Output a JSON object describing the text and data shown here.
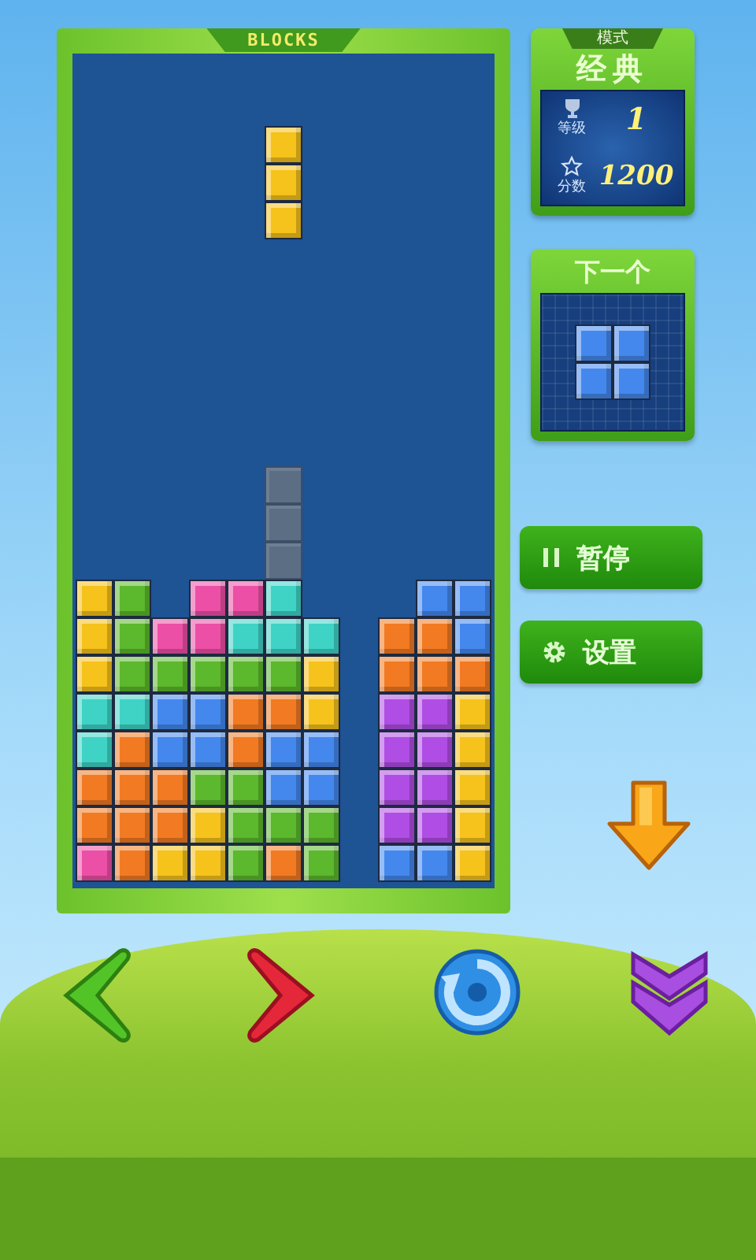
{
  "board": {
    "title": "BLOCKS",
    "rows": [
      [
        null,
        null,
        null,
        null,
        null,
        null,
        null,
        null,
        null,
        null,
        null
      ],
      [
        null,
        null,
        null,
        null,
        null,
        null,
        null,
        null,
        null,
        null,
        null
      ],
      [
        null,
        null,
        null,
        null,
        null,
        {
          "kind": "block",
          "color": "#f6c21c"
        },
        null,
        null,
        null,
        null,
        null
      ],
      [
        null,
        null,
        null,
        null,
        null,
        {
          "kind": "block",
          "color": "#f6c21c"
        },
        null,
        null,
        null,
        null,
        null
      ],
      [
        null,
        null,
        null,
        null,
        null,
        {
          "kind": "block",
          "color": "#f6c21c"
        },
        null,
        null,
        null,
        null,
        null
      ],
      [
        null,
        null,
        null,
        null,
        null,
        null,
        null,
        null,
        null,
        null,
        null
      ],
      [
        null,
        null,
        null,
        null,
        null,
        null,
        null,
        null,
        null,
        null,
        null
      ],
      [
        null,
        null,
        null,
        null,
        null,
        null,
        null,
        null,
        null,
        null,
        null
      ],
      [
        null,
        null,
        null,
        null,
        null,
        null,
        null,
        null,
        null,
        null,
        null
      ],
      [
        null,
        null,
        null,
        null,
        null,
        null,
        null,
        null,
        null,
        null,
        null
      ],
      [
        null,
        null,
        null,
        null,
        null,
        null,
        null,
        null,
        null,
        null,
        null
      ],
      [
        null,
        null,
        null,
        null,
        null,
        {
          "kind": "ghost",
          "color": "#5b6e84"
        },
        null,
        null,
        null,
        null,
        null
      ],
      [
        null,
        null,
        null,
        null,
        null,
        {
          "kind": "ghost",
          "color": "#5b6e84"
        },
        null,
        null,
        null,
        null,
        null
      ],
      [
        null,
        null,
        null,
        null,
        null,
        {
          "kind": "ghost",
          "color": "#5b6e84"
        },
        null,
        null,
        null,
        null,
        null
      ],
      [
        {
          "kind": "block",
          "color": "#f6c21c"
        },
        {
          "kind": "block",
          "color": "#5cb82c"
        },
        null,
        {
          "kind": "block",
          "color": "#ec4fa6"
        },
        {
          "kind": "block",
          "color": "#ec4fa6"
        },
        {
          "kind": "block",
          "color": "#3fd3c6"
        },
        null,
        null,
        null,
        {
          "kind": "block",
          "color": "#4488ee"
        },
        {
          "kind": "block",
          "color": "#4488ee"
        }
      ],
      [
        {
          "kind": "block",
          "color": "#f6c21c"
        },
        {
          "kind": "block",
          "color": "#5cb82c"
        },
        {
          "kind": "block",
          "color": "#ec4fa6"
        },
        {
          "kind": "block",
          "color": "#ec4fa6"
        },
        {
          "kind": "block",
          "color": "#3fd3c6"
        },
        {
          "kind": "block",
          "color": "#3fd3c6"
        },
        {
          "kind": "block",
          "color": "#3fd3c6"
        },
        null,
        {
          "kind": "block",
          "color": "#f27a22"
        },
        {
          "kind": "block",
          "color": "#f27a22"
        },
        {
          "kind": "block",
          "color": "#4488ee"
        }
      ],
      [
        {
          "kind": "block",
          "color": "#f6c21c"
        },
        {
          "kind": "block",
          "color": "#5cb82c"
        },
        {
          "kind": "block",
          "color": "#5cb82c"
        },
        {
          "kind": "block",
          "color": "#5cb82c"
        },
        {
          "kind": "block",
          "color": "#5cb82c"
        },
        {
          "kind": "block",
          "color": "#5cb82c"
        },
        {
          "kind": "block",
          "color": "#f6c21c"
        },
        null,
        {
          "kind": "block",
          "color": "#f27a22"
        },
        {
          "kind": "block",
          "color": "#f27a22"
        },
        {
          "kind": "block",
          "color": "#f27a22"
        }
      ],
      [
        {
          "kind": "block",
          "color": "#3fd3c6"
        },
        {
          "kind": "block",
          "color": "#3fd3c6"
        },
        {
          "kind": "block",
          "color": "#4488ee"
        },
        {
          "kind": "block",
          "color": "#4488ee"
        },
        {
          "kind": "block",
          "color": "#f27a22"
        },
        {
          "kind": "block",
          "color": "#f27a22"
        },
        {
          "kind": "block",
          "color": "#f6c21c"
        },
        null,
        {
          "kind": "block",
          "color": "#b04de4"
        },
        {
          "kind": "block",
          "color": "#b04de4"
        },
        {
          "kind": "block",
          "color": "#f6c21c"
        }
      ],
      [
        {
          "kind": "block",
          "color": "#3fd3c6"
        },
        {
          "kind": "block",
          "color": "#f27a22"
        },
        {
          "kind": "block",
          "color": "#4488ee"
        },
        {
          "kind": "block",
          "color": "#4488ee"
        },
        {
          "kind": "block",
          "color": "#f27a22"
        },
        {
          "kind": "block",
          "color": "#4488ee"
        },
        {
          "kind": "block",
          "color": "#4488ee"
        },
        null,
        {
          "kind": "block",
          "color": "#b04de4"
        },
        {
          "kind": "block",
          "color": "#b04de4"
        },
        {
          "kind": "block",
          "color": "#f6c21c"
        }
      ],
      [
        {
          "kind": "block",
          "color": "#f27a22"
        },
        {
          "kind": "block",
          "color": "#f27a22"
        },
        {
          "kind": "block",
          "color": "#f27a22"
        },
        {
          "kind": "block",
          "color": "#5cb82c"
        },
        {
          "kind": "block",
          "color": "#5cb82c"
        },
        {
          "kind": "block",
          "color": "#4488ee"
        },
        {
          "kind": "block",
          "color": "#4488ee"
        },
        null,
        {
          "kind": "block",
          "color": "#b04de4"
        },
        {
          "kind": "block",
          "color": "#b04de4"
        },
        {
          "kind": "block",
          "color": "#f6c21c"
        }
      ],
      [
        {
          "kind": "block",
          "color": "#f27a22"
        },
        {
          "kind": "block",
          "color": "#f27a22"
        },
        {
          "kind": "block",
          "color": "#f27a22"
        },
        {
          "kind": "block",
          "color": "#f6c21c"
        },
        {
          "kind": "block",
          "color": "#5cb82c"
        },
        {
          "kind": "block",
          "color": "#5cb82c"
        },
        {
          "kind": "block",
          "color": "#5cb82c"
        },
        null,
        {
          "kind": "block",
          "color": "#b04de4"
        },
        {
          "kind": "block",
          "color": "#b04de4"
        },
        {
          "kind": "block",
          "color": "#f6c21c"
        }
      ],
      [
        {
          "kind": "block",
          "color": "#ec4fa6"
        },
        {
          "kind": "block",
          "color": "#f27a22"
        },
        {
          "kind": "block",
          "color": "#f6c21c"
        },
        {
          "kind": "block",
          "color": "#f6c21c"
        },
        {
          "kind": "block",
          "color": "#5cb82c"
        },
        {
          "kind": "block",
          "color": "#f27a22"
        },
        {
          "kind": "block",
          "color": "#5cb82c"
        },
        null,
        {
          "kind": "block",
          "color": "#4488ee"
        },
        {
          "kind": "block",
          "color": "#4488ee"
        },
        {
          "kind": "block",
          "color": "#f6c21c"
        }
      ]
    ]
  },
  "mode_panel": {
    "label": "模式",
    "mode": "经典",
    "level_label": "等级",
    "level_value": "1",
    "score_label": "分数",
    "score_value": "1200"
  },
  "next_panel": {
    "title": "下一个",
    "cells": [
      [
        {
          "kind": "block",
          "color": "#4488ee"
        },
        {
          "kind": "block",
          "color": "#4488ee"
        }
      ],
      [
        {
          "kind": "block",
          "color": "#4488ee"
        },
        {
          "kind": "block",
          "color": "#4488ee"
        }
      ]
    ]
  },
  "buttons": [
    {
      "kind": "pause",
      "label": "暂停"
    },
    {
      "kind": "settings",
      "label": "设置"
    }
  ],
  "controls": [
    {
      "kind": "left"
    },
    {
      "kind": "right"
    },
    {
      "kind": "rotate"
    },
    {
      "kind": "drop"
    }
  ]
}
